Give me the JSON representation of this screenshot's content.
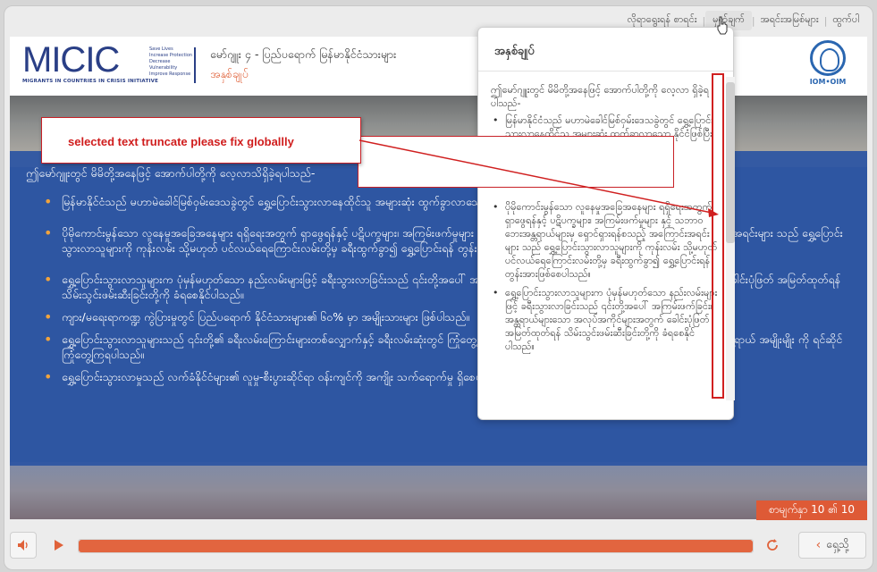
{
  "topnav": {
    "items": [
      "လိုရာရွေးရန် စာရင်း",
      "မှတ်ချက်",
      "အရင်းအမြစ်များ",
      "ထွက်ပါ"
    ]
  },
  "slide": {
    "logo": "MICIC",
    "tagline": "Save Lives\nIncrease Protection\nDecrease Vulnerability\nImprove Response",
    "logo_sub": "MIGRANTS IN COUNTRIES IN CRISIS INITIATIVE",
    "title": "မော်ဂျူး ၄ - ပြည်ပရောက် မြန်မာနိုင်ငံသားများ",
    "subtitle": "အနှစ်ချုပ်",
    "iom_label": "IOM•OIM",
    "intro": "ဤမော်ဂျူးတွင် မိမိတို့အနေဖြင့် အောက်ပါတို့ကို လေ့လာသိရှိခဲ့ရပါသည်-",
    "bullets": [
      "မြန်မာနိုင်ငံသည် မဟာမဲခေါင်မြစ်ဝှမ်းဒေသခွဲတွင် ရွှေ့ပြောင်းသွားလာနေထိုင်သူ အများဆုံး ထွက်ခွာလာသော နိုင်ငံဖြစ်ပြီး ထိုင်းနိုင်ငံသို့ အဓိကသွားရောက်ကြပါသည်။",
      "ပိုမိုကောင်းမွန်သော လူနေမှုအခြေအနေများ ရရှိရေးအတွက် ရှာဖွေရန်နှင့် ပဋိပက္ခများ၊ အကြမ်းဖက်မှုများ နှင့် သဘာဝဘေးအန္တရာယ်များမှ ရှောင်ရှားရန်စသည့် အကြောင်းအရင်းများ သည် ရွှေ့ပြောင်းသွားလာသူများကို ကုန်းလမ်း သို့မဟုတ် ပင်လယ်ရေကြောင်းလမ်းတို့မှ ခရီးထွက်ခွာ၍ ရွှေ့ပြောင်းရန် တွန်းအားဖြစ်စေပါသည်။",
      "ရွှေ့ပြောင်းသွားလာသူများက ပုံမှန်မဟုတ်သော နည်းလမ်းများဖြင့် ခရီးသွားလာခြင်းသည် ၎င်းတို့အပေါ် အကြမ်းဖက်ခြင်း၊ အန္တရာယ်များသော အလုပ်အကိုင်များအတွက် ခေါင်းပုံဖြတ် အမြတ်ထုတ်ရန် သိမ်းသွင်းဖမ်းဆီးခြင်းတို့ကို ခံရစေနိုင်ပါသည်။",
      "ကျား/မရေးရာကဏ္ဍ ကွဲပြားမှုတွင် ပြည်ပရောက် နိုင်ငံသားများ၏ ၆၀% မှာ အမျိုးသားများ ဖြစ်ပါသည်။",
      "ရွှေ့ပြောင်းသွားလာသူများသည် ၎င်းတို့၏ ခရီးလမ်းကြောင်းများတစ်လျှောက်နှင့် ခရီးလမ်းဆုံးတွင် ကြုံတွေ့ရနိုင်သော အန္တရာယ်များနှင့် ရင်ဆိုင်ရခြင်း ဖြစ်ပွားသော ဘေးအန္တရာယ် အမျိုးမျိုး ကို ရင်ဆိုင်ကြုံတွေ့ကြရပါသည်။",
      "ရွှေ့ပြောင်းသွားလာမှုသည် လက်ခံနိုင်ငံများ၏ လူမှု-စီးပွားဆိုင်ရာ ဝန်းကျင်ကို အကျိုး သက်ရောက်မှု ရှိစေပါသည်။"
    ],
    "page_count": "စာမျက်နှာ 10 ၏ 10"
  },
  "annotation": {
    "text": "selected text truncate please fix globallly"
  },
  "popup": {
    "title": "အနှစ်ချုပ်",
    "intro": "ဤမော်ဂျူးတွင် မိမိတို့အနေဖြင့် အောက်ပါတို့ကို လေ့လာ ရှိခဲ့ရပါသည်-",
    "items": [
      "မြန်မာနိုင်ငံသည် မဟာမဲခေါင်မြစ်ဝှမ်းဒေသခွဲတွင် ရွှေ့ပြောင်းသွားလာနေထိုင်သူ အများဆုံး ထွက်ခွာလာသော နိုင်ငံဖြစ်ပြီး ထိုင်းနိုင်ငံသို့ အဓိက သွားရောက်ကြပါသည်။",
      "ပိုမိုကောင်းမွန်သော လူနေမှုအခြေအနေများ ရရှိရေးအတွက် ရှာဖွေရန်နှင့် ပဋိပက္ခများ၊ အကြမ်းဖက်မှုများ နှင့် သဘာဝဘေးအန္တရာယ်များမှ ရှောင်ရှားရန်စသည့် အကြောင်းအရင်းများ သည် ရွှေ့ပြောင်းသွားလာသူများကို ကုန်းလမ်း သို့မဟုတ် ပင်လယ်ရေကြောင်းလမ်းတို့မှ ခရီးထွက်ခွာ၍ ရွှေ့ပြောင်းရန် တွန်းအားဖြစ်စေပါသည်။",
      "ရွှေ့ပြောင်းသွားလာသူများက ပုံမှန်မဟုတ်သော နည်းလမ်းများဖြင့် ခရီးသွားလာခြင်းသည် ၎င်းတို့အပေါ် အကြမ်းဖက်ခြင်း၊ အန္တရာယ်များသော အလုပ်အကိုင်များအတွက် ခေါင်းပုံဖြတ် အမြတ်ထုတ်ရန် သိမ်းသွင်းဖမ်းဆီးခြင်းတို့ကို ခံရစေနိုင်ပါသည်။"
    ]
  },
  "player": {
    "progress": 1.0,
    "prev_label": "ရှေ့သို့"
  },
  "colors": {
    "accent": "#e0623a",
    "blue": "#2e56a2",
    "annotation_red": "#d01d1d"
  }
}
